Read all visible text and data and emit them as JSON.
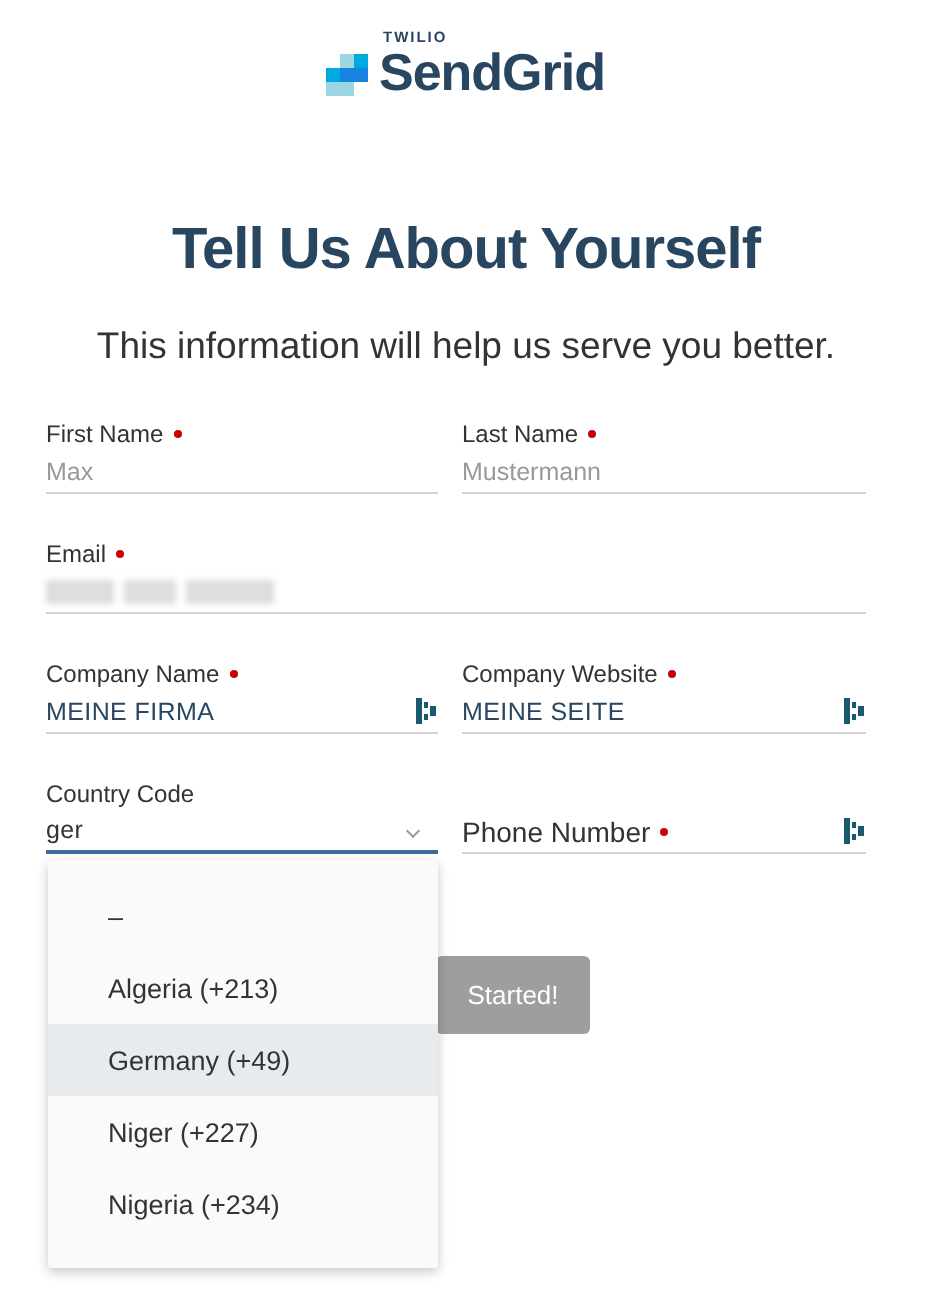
{
  "logo": {
    "parent": "TWILIO",
    "brand": "SendGrid"
  },
  "heading": "Tell Us About Yourself",
  "subheading": "This information will help us serve you better.",
  "fields": [
    {
      "label": "First Name",
      "required": true,
      "placeholder": "Max"
    },
    {
      "label": "Last Name",
      "required": true,
      "placeholder": "Mustermann"
    },
    {
      "label": "Email",
      "required": true,
      "redacted": true,
      "wide": true
    },
    {
      "label": "Company Name",
      "required": true,
      "value": "MEINE FIRMA",
      "autofill_icon": true
    },
    {
      "label": "Company Website",
      "required": true,
      "value": "MEINE SEITE",
      "autofill_icon": true
    },
    {
      "label": "Country Code",
      "required": false,
      "value": "ger",
      "focused": true,
      "dropdown": true
    },
    {
      "label": "Phone Number",
      "required": true,
      "autofill_icon": true
    }
  ],
  "dropdown_options": [
    {
      "label": "–",
      "selected": false
    },
    {
      "label": "Algeria (+213)",
      "selected": false
    },
    {
      "label": "Germany (+49)",
      "selected": true
    },
    {
      "label": "Niger (+227)",
      "selected": false
    },
    {
      "label": "Nigeria (+234)",
      "selected": false
    }
  ],
  "submit_button": {
    "label": "Started!",
    "disabled": true
  }
}
